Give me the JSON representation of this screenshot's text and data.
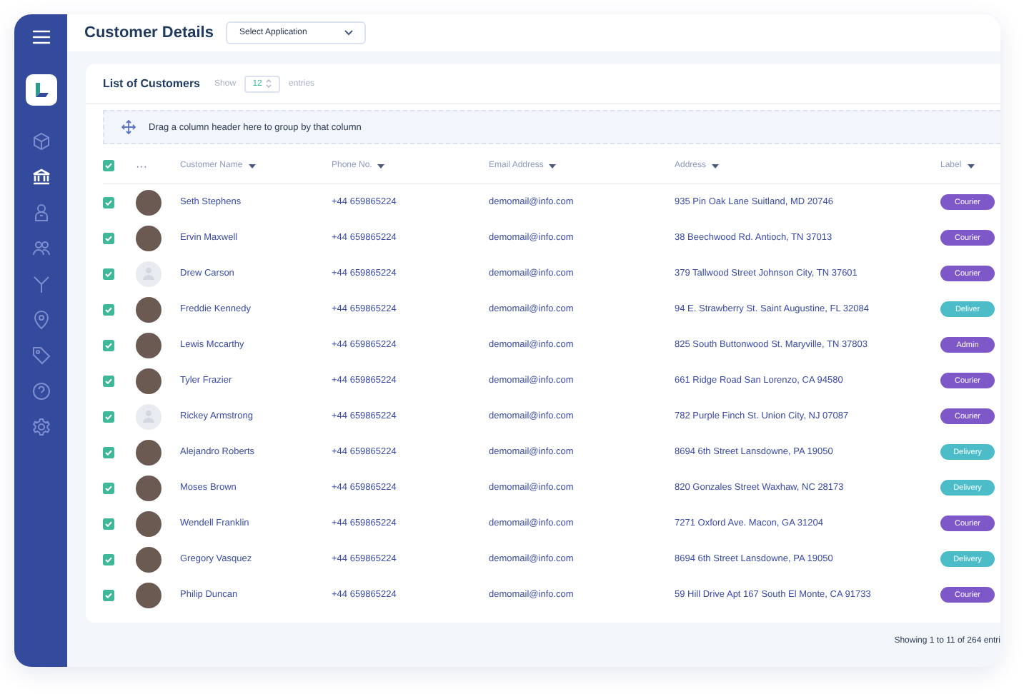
{
  "header": {
    "title": "Customer Details",
    "app_select": {
      "placeholder": "Select Application"
    }
  },
  "sidebar": {
    "items": [
      {
        "selected": false
      },
      {
        "selected": true
      },
      {
        "selected": false
      },
      {
        "selected": false
      },
      {
        "selected": false
      },
      {
        "selected": false
      },
      {
        "selected": false
      },
      {
        "selected": false
      },
      {
        "selected": false
      }
    ]
  },
  "card": {
    "title": "List of Customers",
    "show_label": "Show",
    "page_size": "12",
    "entries_label": "entries",
    "group_hint": "Drag a column header here to group by that column"
  },
  "table": {
    "all_checked": true,
    "more": "···",
    "columns": [
      "Customer Name",
      "Phone No.",
      "Email Address",
      "Address",
      "Label"
    ],
    "rows": [
      {
        "checked": true,
        "kind": "photo",
        "name": "Seth Stephens",
        "phone": "+44 659865224",
        "email": "demomail@info.com",
        "address": "935 Pin Oak Lane Suitland, MD 20746",
        "label": "Courier",
        "color": "#7e57c8"
      },
      {
        "checked": true,
        "kind": "photo",
        "name": "Ervin Maxwell",
        "phone": "+44 659865224",
        "email": "demomail@info.com",
        "address": "38 Beechwood Rd. Antioch, TN 37013",
        "label": "Courier",
        "color": "#7e57c8"
      },
      {
        "checked": true,
        "kind": "placeholder",
        "name": "Drew Carson",
        "phone": "+44 659865224",
        "email": "demomail@info.com",
        "address": "379 Tallwood Street Johnson City, TN 37601",
        "label": "Courier",
        "color": "#7e57c8"
      },
      {
        "checked": true,
        "kind": "photo",
        "name": "Freddie Kennedy",
        "phone": "+44 659865224",
        "email": "demomail@info.com",
        "address": "94 E. Strawberry St. Saint Augustine, FL 32084",
        "label": "Deliver",
        "color": "#4cbdc8"
      },
      {
        "checked": true,
        "kind": "photo",
        "name": "Lewis Mccarthy",
        "phone": "+44 659865224",
        "email": "demomail@info.com",
        "address": "825 South Buttonwood St. Maryville, TN 37803",
        "label": "Admin",
        "color": "#7e57c8"
      },
      {
        "checked": true,
        "kind": "photo",
        "name": "Tyler Frazier",
        "phone": "+44 659865224",
        "email": "demomail@info.com",
        "address": "661 Ridge Road San Lorenzo, CA 94580",
        "label": "Courier",
        "color": "#7e57c8"
      },
      {
        "checked": true,
        "kind": "placeholder",
        "name": "Rickey Armstrong",
        "phone": "+44 659865224",
        "email": "demomail@info.com",
        "address": "782 Purple Finch St. Union City, NJ 07087",
        "label": "Courier",
        "color": "#7e57c8"
      },
      {
        "checked": true,
        "kind": "photo",
        "name": "Alejandro Roberts",
        "phone": "+44 659865224",
        "email": "demomail@info.com",
        "address": "8694 6th Street Lansdowne, PA 19050",
        "label": "Delivery",
        "color": "#4cbdc8"
      },
      {
        "checked": true,
        "kind": "photo",
        "name": "Moses Brown",
        "phone": "+44 659865224",
        "email": "demomail@info.com",
        "address": "820 Gonzales Street Waxhaw, NC 28173",
        "label": "Delivery",
        "color": "#4cbdc8"
      },
      {
        "checked": true,
        "kind": "photo",
        "name": "Wendell Franklin",
        "phone": "+44 659865224",
        "email": "demomail@info.com",
        "address": "7271 Oxford Ave. Macon, GA 31204",
        "label": "Courier",
        "color": "#7e57c8"
      },
      {
        "checked": true,
        "kind": "photo",
        "name": "Gregory Vasquez",
        "phone": "+44 659865224",
        "email": "demomail@info.com",
        "address": "8694 6th Street Lansdowne, PA 19050",
        "label": "Delivery",
        "color": "#4cbdc8"
      },
      {
        "checked": true,
        "kind": "photo",
        "name": "Philip Duncan",
        "phone": "+44 659865224",
        "email": "demomail@info.com",
        "address": "59 Hill Drive Apt 167 South El Monte, CA 91733",
        "label": "Courier",
        "color": "#7e57c8"
      }
    ]
  },
  "footer": {
    "summary": "Showing 1 to 11 of 264 entri"
  }
}
